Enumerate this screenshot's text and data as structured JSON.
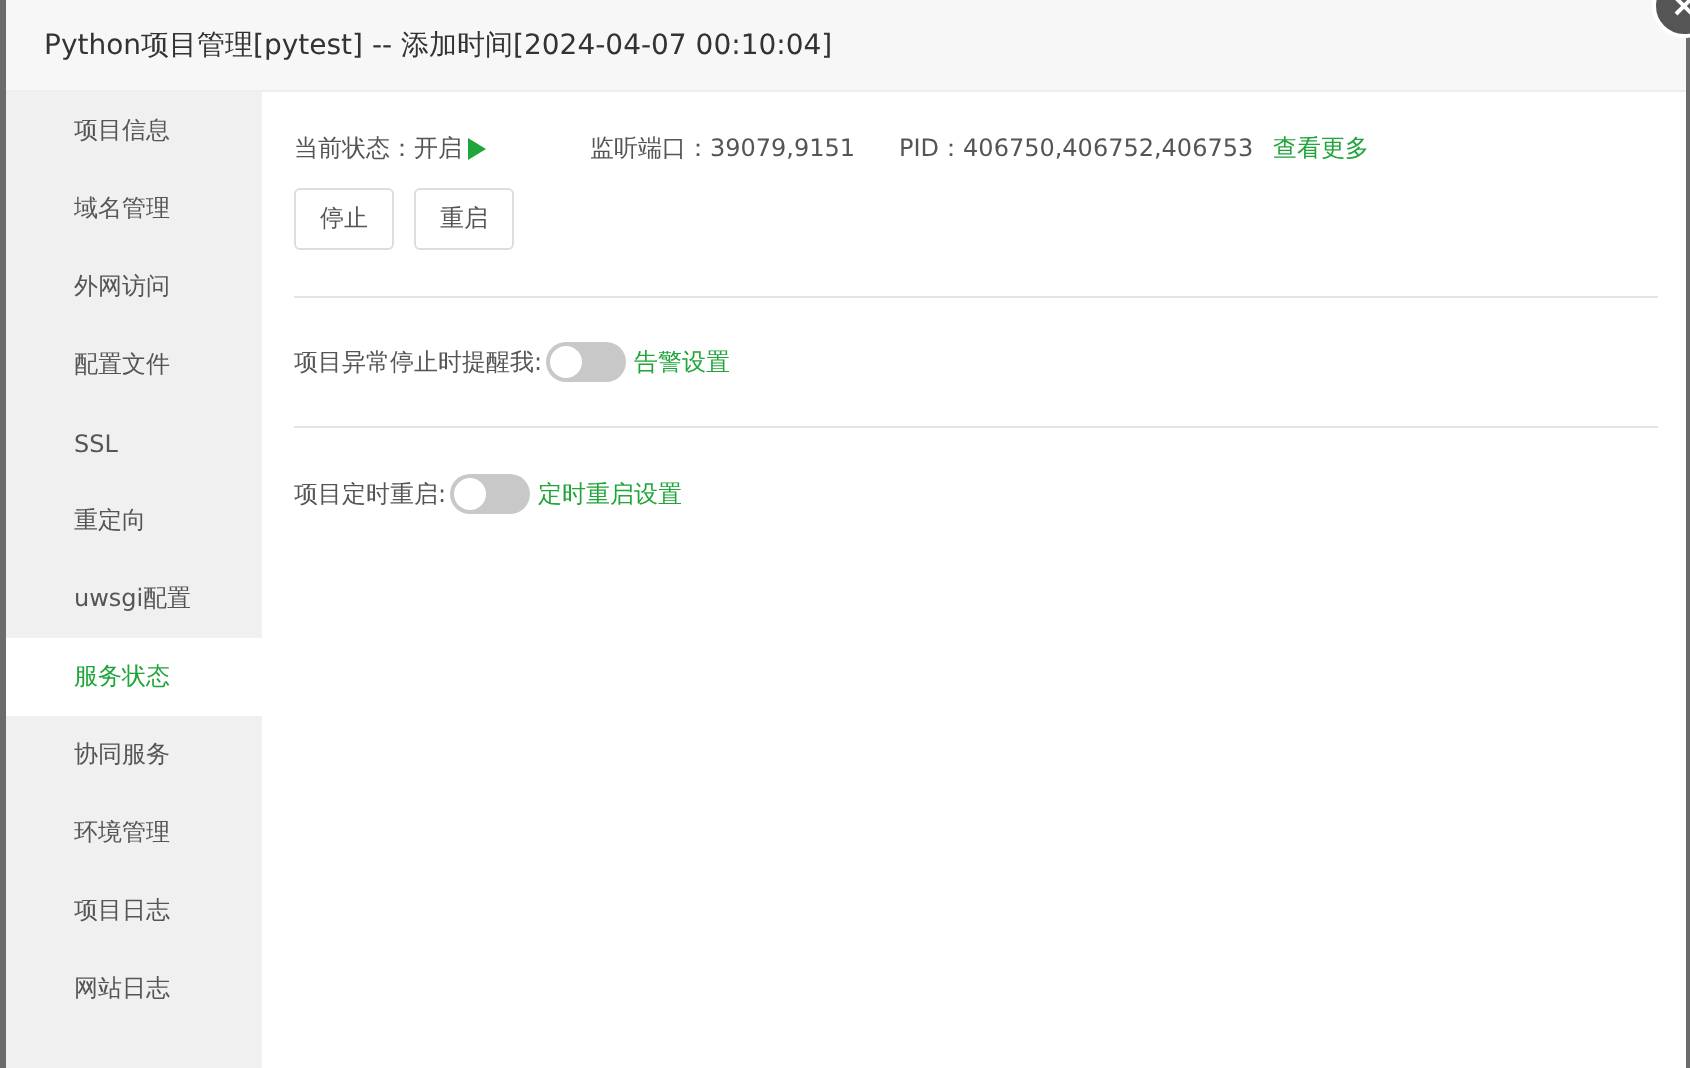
{
  "window": {
    "title": "Python项目管理[pytest] -- 添加时间[2024-04-07 00:10:04]"
  },
  "sidebar": {
    "items": [
      {
        "label": "项目信息",
        "selected": false
      },
      {
        "label": "域名管理",
        "selected": false
      },
      {
        "label": "外网访问",
        "selected": false
      },
      {
        "label": "配置文件",
        "selected": false
      },
      {
        "label": "SSL",
        "selected": false
      },
      {
        "label": "重定向",
        "selected": false
      },
      {
        "label": "uwsgi配置",
        "selected": false
      },
      {
        "label": "服务状态",
        "selected": true
      },
      {
        "label": "协同服务",
        "selected": false
      },
      {
        "label": "环境管理",
        "selected": false
      },
      {
        "label": "项目日志",
        "selected": false
      },
      {
        "label": "网站日志",
        "selected": false
      }
    ]
  },
  "status": {
    "state_label": "当前状态：开启",
    "running": true,
    "ports": "监听端口：39079,9151",
    "pid": "PID：406750,406752,406753",
    "more_link": "查看更多"
  },
  "buttons": [
    "停止",
    "重启"
  ],
  "settings": [
    {
      "label": "项目异常停止时提醒我:",
      "on": false,
      "link": "告警设置"
    },
    {
      "label": "项目定时重启:",
      "on": false,
      "link": "定时重启设置"
    }
  ]
}
